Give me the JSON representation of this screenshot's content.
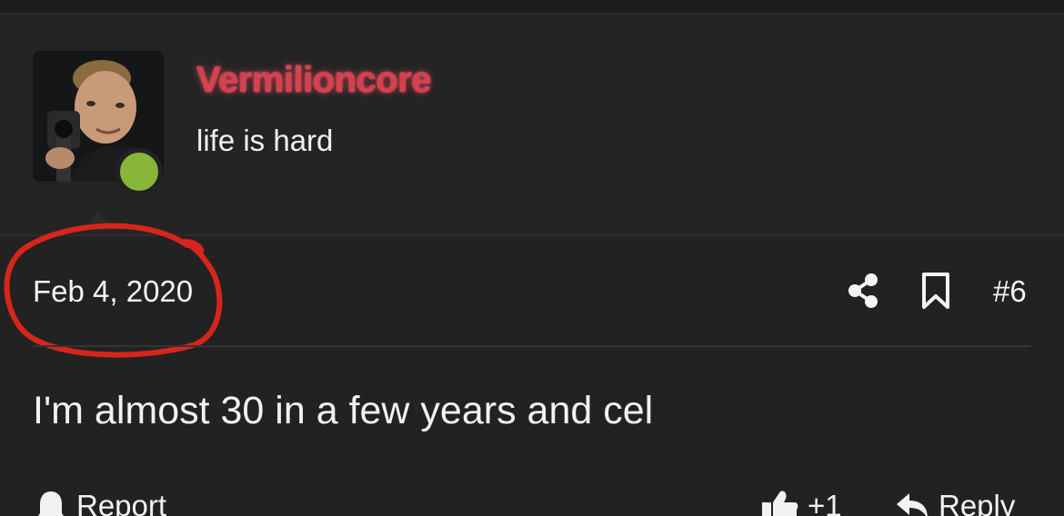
{
  "user": {
    "username": "Vermilioncore",
    "title": "life is hard"
  },
  "post": {
    "date": "Feb 4, 2020",
    "number": "#6",
    "body": "I'm almost 30 in a few years and cel"
  },
  "footer": {
    "report_label": "Report",
    "like_count": "+1",
    "reply_label": "Reply"
  },
  "icons": {
    "share": "share-icon",
    "bookmark": "bookmark-icon",
    "report": "bell-icon",
    "like": "thumbs-up-icon",
    "reply": "reply-icon"
  },
  "colors": {
    "background": "#222222",
    "username": "#d8404e",
    "online": "#88b638",
    "annotation": "#d8251c"
  }
}
